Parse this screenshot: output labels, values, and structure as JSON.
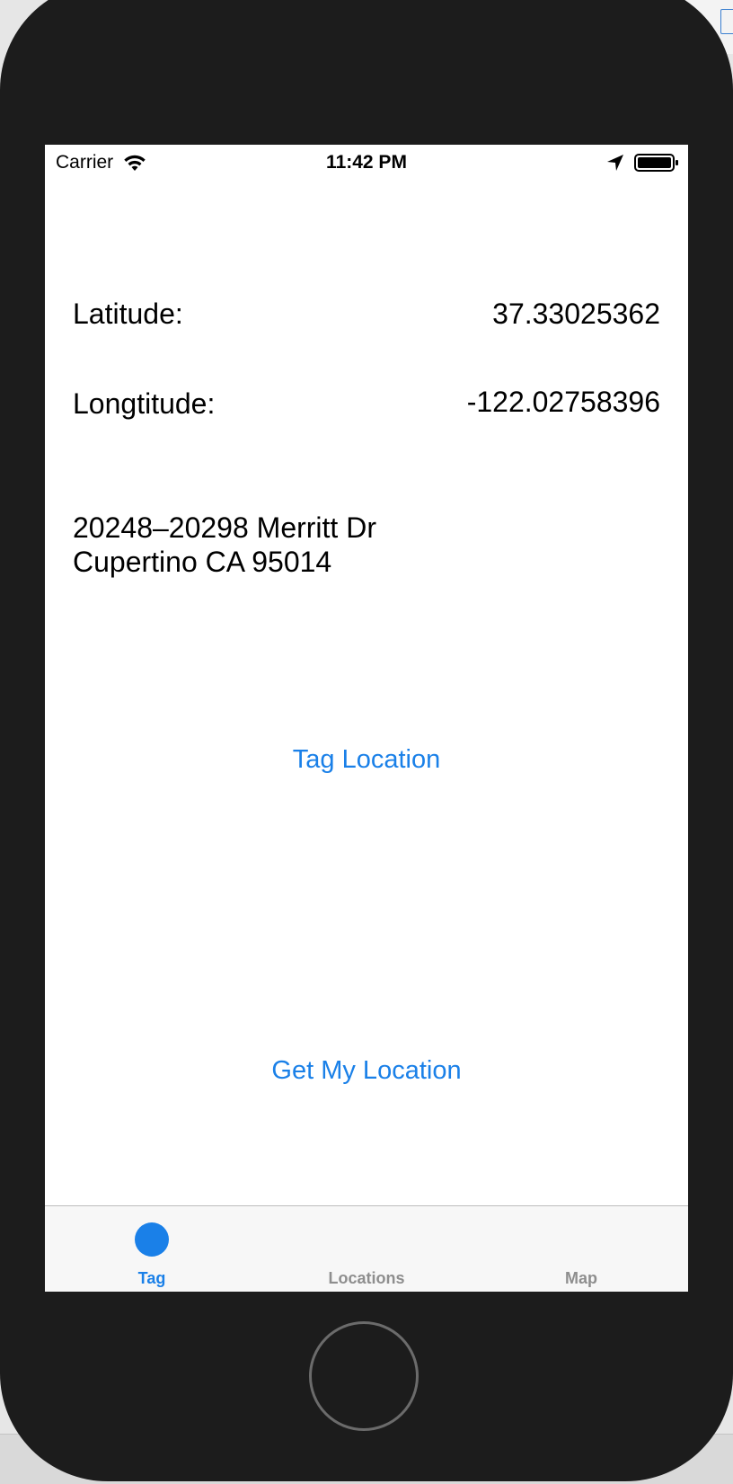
{
  "status_bar": {
    "carrier": "Carrier",
    "time": "11:42 PM",
    "icons": [
      "wifi-icon",
      "location-arrow-icon",
      "battery-icon"
    ]
  },
  "location": {
    "latitude_label": "Latitude:",
    "latitude_value": "37.33025362",
    "longitude_label": "Longtitude:",
    "longitude_value": "-122.02758396"
  },
  "address": {
    "line1": "20248–20298 Merritt Dr",
    "line2": "Cupertino CA 95014"
  },
  "buttons": {
    "tag_location": "Tag Location",
    "get_my_location": "Get My Location"
  },
  "tab_bar": {
    "tabs": [
      {
        "label": "Tag",
        "selected": true,
        "icon": "tag-tab-icon"
      },
      {
        "label": "Locations",
        "selected": false
      },
      {
        "label": "Map",
        "selected": false
      }
    ]
  },
  "colors": {
    "tint": "#1a80e8",
    "inactive_tab": "#8e8e8e",
    "device_body": "#1c1c1c"
  }
}
